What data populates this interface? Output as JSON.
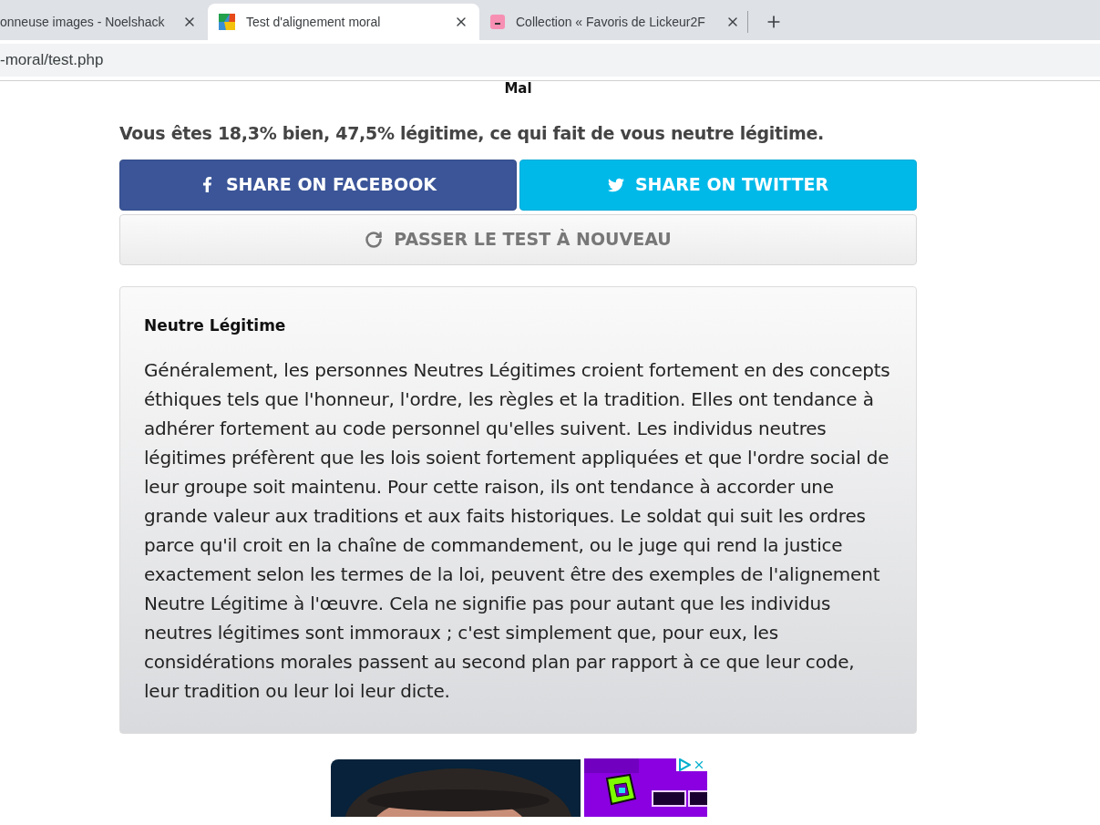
{
  "tabs": [
    {
      "title": "onneuse images - Noelshack",
      "selected": false,
      "kind": "plain"
    },
    {
      "title": "Test d'alignement moral",
      "selected": true,
      "kind": "test"
    },
    {
      "title": "Collection « Favoris de Lickeur2F",
      "selected": false,
      "kind": "pink"
    }
  ],
  "address": "-moral/test.php",
  "top_heading": "Mal",
  "result": "Vous êtes 18,3% bien, 47,5% légitime, ce qui fait de vous neutre légitime.",
  "share_buttons": [
    {
      "label": "SHARE ON FACEBOOK",
      "kind": "facebook"
    },
    {
      "label": "SHARE ON TWITTER",
      "kind": "twitter"
    }
  ],
  "retake_button": "PASSER LE TEST À NOUVEAU",
  "description": {
    "title": "Neutre Légitime",
    "text": "Généralement, les personnes Neutres Légitimes croient fortement en des concepts éthiques tels que l'honneur, l'ordre, les règles et la tradition. Elles ont tendance à adhérer fortement au code personnel qu'elles suivent. Les individus neutres légitimes préfèrent que les lois soient fortement appliquées et que l'ordre social de leur groupe soit maintenu. Pour cette raison, ils ont tendance à accorder une grande valeur aux traditions et aux faits historiques. Le soldat qui suit les ordres parce qu'il croit en la chaîne de commandement, ou le juge qui rend la justice exactement selon les termes de la loi, peuvent être des exemples de l'alignement Neutre Légitime à l'œuvre. Cela ne signifie pas pour autant que les individus neutres légitimes sont immoraux ; c'est simplement que, pour eux, les considérations morales passent au second plan par rapport à ce que leur code, leur tradition ou leur loi leur dicte."
  }
}
